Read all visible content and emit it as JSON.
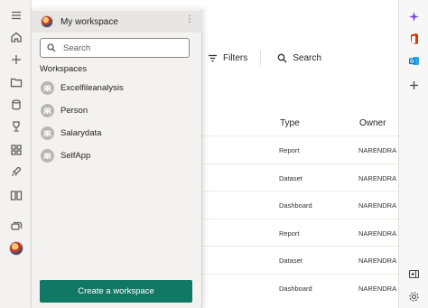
{
  "panel": {
    "title": "My workspace",
    "more": "⋮",
    "search_placeholder": "Search",
    "section_label": "Workspaces",
    "workspaces": [
      {
        "name": "Excelfileanalysis"
      },
      {
        "name": "Person"
      },
      {
        "name": "Salarydata"
      },
      {
        "name": "SelfApp"
      }
    ],
    "create_button": "Create a workspace"
  },
  "toolbar": {
    "filters_label": "Filters",
    "search_label": "Search"
  },
  "table": {
    "headers": {
      "type": "Type",
      "owner": "Owner"
    },
    "rows": [
      {
        "type": "Report",
        "owner": "NARENDRA K"
      },
      {
        "type": "Dataset",
        "owner": "NARENDRA K"
      },
      {
        "type": "Dashboard",
        "owner": "NARENDRA K"
      },
      {
        "type": "Report",
        "owner": "NARENDRA K"
      },
      {
        "type": "Dataset",
        "owner": "NARENDRA K"
      },
      {
        "type": "Dashboard",
        "owner": "NARENDRA K"
      }
    ]
  },
  "rail_icons": [
    "hamburger-icon",
    "home-icon",
    "create-icon",
    "browse-icon",
    "datahub-icon",
    "goals-icon",
    "apps-icon",
    "deployment-icon",
    "learn-icon",
    "workspaces-icon"
  ],
  "edge_icons": [
    "copilot-icon",
    "office-icon",
    "outlook-icon",
    "add-icon",
    "sidebar-collapse-icon",
    "settings-icon"
  ],
  "colors": {
    "accent": "#117865",
    "panel_bg": "#f3f2f1",
    "header_bg": "#e8e6e4",
    "workspace_icon": "#b9b7b5"
  }
}
